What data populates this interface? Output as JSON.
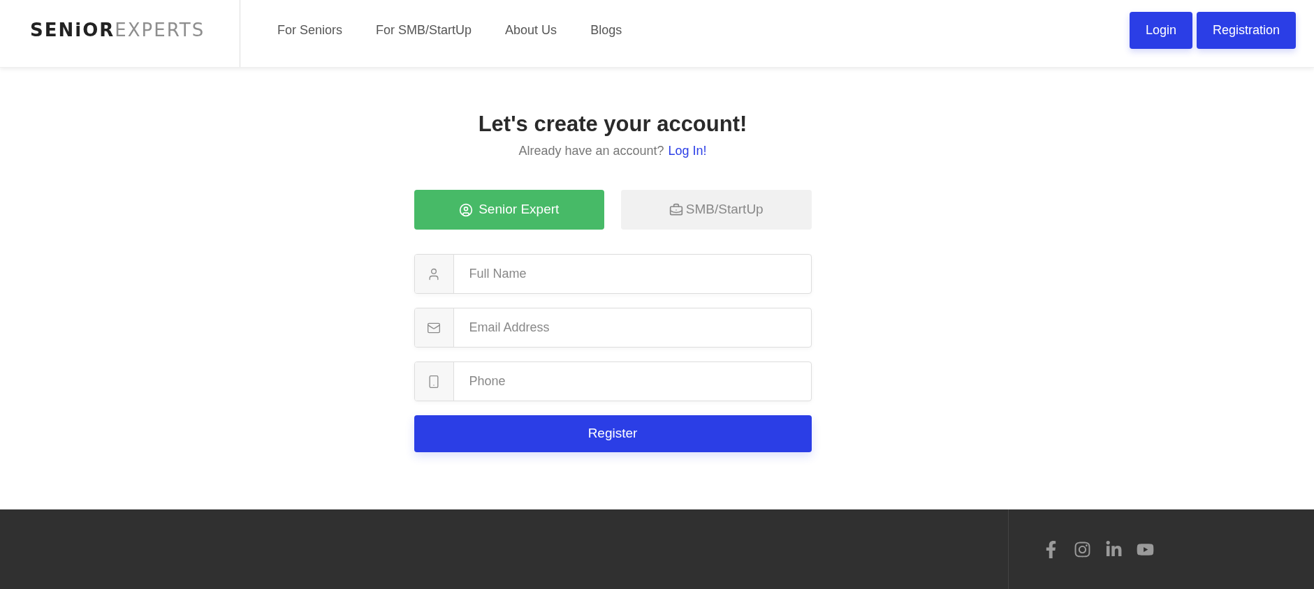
{
  "header": {
    "logo": {
      "part_1": "SENiOR",
      "part_2": "EXPERTS"
    },
    "nav": [
      "For Seniors",
      "For SMB/StartUp",
      "About Us",
      "Blogs"
    ],
    "buttons": [
      "Login",
      "Registration"
    ]
  },
  "form": {
    "title": "Let's create your account!",
    "subtitle": "Already have an account?",
    "login_link": "Log In!",
    "tabs": [
      {
        "label": "Senior Expert",
        "kind": "person",
        "selected": true
      },
      {
        "label": "SMB/StartUp",
        "kind": "business",
        "selected": false
      }
    ],
    "fields": [
      {
        "placeholder": "Full Name",
        "kind": "name"
      },
      {
        "placeholder": "Email Address",
        "kind": "email"
      },
      {
        "placeholder": "Phone",
        "kind": "phone"
      }
    ],
    "submit": "Register"
  },
  "footer": {
    "social": [
      {
        "kind": "facebook"
      },
      {
        "kind": "instagram"
      },
      {
        "kind": "linkedin"
      },
      {
        "kind": "youtube"
      }
    ]
  }
}
